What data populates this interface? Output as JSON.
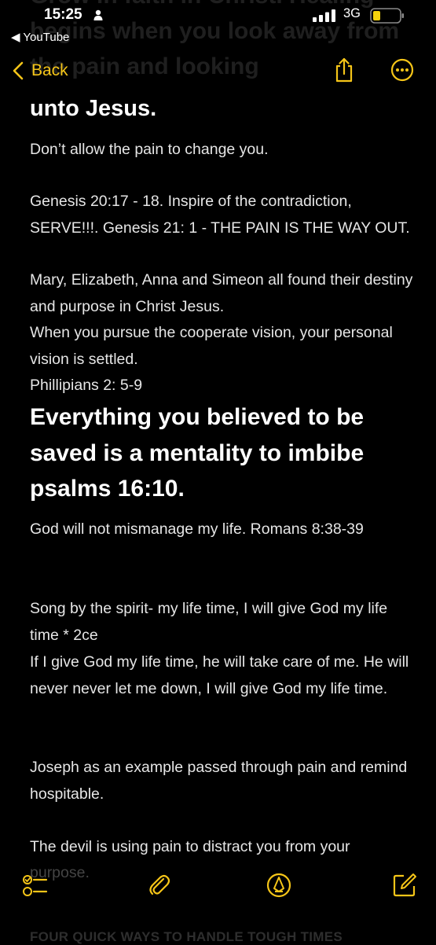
{
  "status_bar": {
    "time": "15:25",
    "back_app": "◀ YouTube",
    "network": "3G",
    "battery_color": "#f5d30c"
  },
  "nav": {
    "back_label": "Back",
    "accent": "#f5c518"
  },
  "note": {
    "ghost_heading": "Grow in faith in Christ. Healing begins when you look away from the pain and looking",
    "heading_partial": "unto Jesus.",
    "paragraphs": [
      "Don’t allow the pain to change you.",
      "Genesis 20:17 - 18. Inspire of the contradiction, SERVE!!!. Genesis 21: 1 - THE PAIN IS THE WAY OUT.",
      "Mary, Elizabeth, Anna and Simeon all found their destiny and purpose in Christ Jesus.",
      "When you pursue the cooperate vision, your personal vision is settled.",
      "Phillipians 2: 5-9"
    ],
    "heading2": " Everything you believed to be saved is a mentality to imbibe psalms 16:10.",
    "paragraphs2": [
      "God will not mismanage my life. Romans 8:38-39",
      "Song by the spirit- my life time, I will give God my life time * 2ce",
      "If I give God my life time, he will take care of me. He will never never let me down, I will give God my life time.",
      "Joseph as an example passed through pain and remind hospitable.",
      "The devil is using pain to distract you from your",
      "purpose.",
      "FOUR QUICK WAYS TO HANDLE TOUGH TIMES"
    ]
  }
}
